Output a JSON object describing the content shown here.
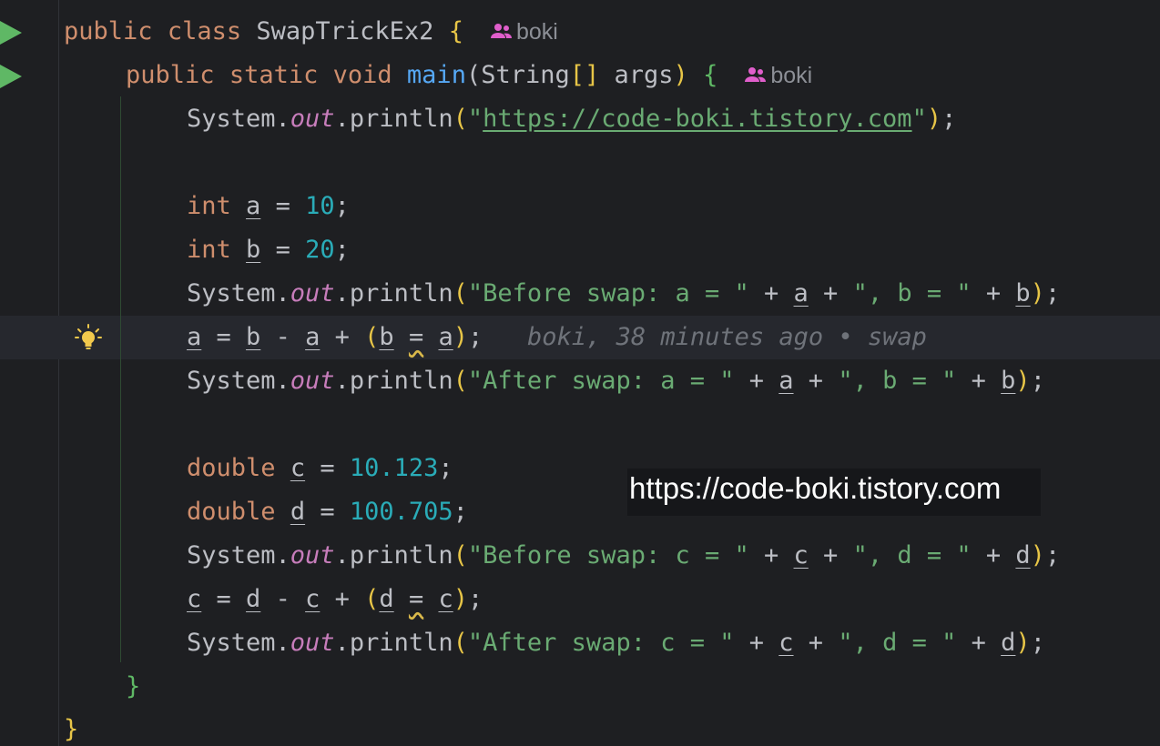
{
  "editor": {
    "lines": [
      {
        "kw1": "public",
        "kw2": "class",
        "name": "SwapTrickEx2",
        "brace": "{",
        "author": "boki"
      },
      {
        "kw1": "public",
        "kw2": "static",
        "kw3": "void",
        "fn": "main",
        "params_open": "(String",
        "brackets": "[]",
        "arg": " args",
        "paren_close": ")",
        "brace": "{",
        "author": "boki"
      },
      {
        "obj": "System.",
        "field": "out",
        "call": ".println",
        "paren_open": "(",
        "quote_open": "\"",
        "url": "https://code-boki.tistory.com",
        "quote_close": "\"",
        "paren_close": ")",
        "end": ";"
      },
      {
        "type": "int",
        "var": "a",
        "op": " = ",
        "value": "10",
        "end": ";"
      },
      {
        "type": "int",
        "var": "b",
        "op": " = ",
        "value": "20",
        "end": ";"
      },
      {
        "obj": "System.",
        "field": "out",
        "call": ".println",
        "str1": "\"Before swap: a = \"",
        "str2": "\", b = \"",
        "v1": "a",
        "v2": "b"
      },
      {
        "v1": "a",
        "v2": "b",
        "v3": "a",
        "v4": "b",
        "v5": "a",
        "blame": "boki, 38 minutes ago • swap"
      },
      {
        "obj": "System.",
        "field": "out",
        "call": ".println",
        "str1": "\"After swap: a = \"",
        "str2": "\", b = \"",
        "v1": "a",
        "v2": "b"
      },
      {
        "type": "double",
        "var": "c",
        "op": " = ",
        "value": "10.123",
        "end": ";"
      },
      {
        "type": "double",
        "var": "d",
        "op": " = ",
        "value": "100.705",
        "end": ";"
      },
      {
        "obj": "System.",
        "field": "out",
        "call": ".println",
        "str1": "\"Before swap: c = \"",
        "str2": "\", d = \"",
        "v1": "c",
        "v2": "d"
      },
      {
        "v1": "c",
        "v2": "d",
        "v3": "c",
        "v4": "d",
        "v5": "c"
      },
      {
        "obj": "System.",
        "field": "out",
        "call": ".println",
        "str1": "\"After swap: c = \"",
        "str2": "\", d = \"",
        "v1": "c",
        "v2": "d"
      },
      {
        "brace": "}"
      },
      {
        "brace": "}"
      }
    ]
  },
  "watermark": {
    "text": "https://code-boki.tistory.com"
  },
  "colors": {
    "background": "#1e1f22",
    "keyword": "#cf8e6d",
    "function": "#56a8f5",
    "number": "#2aacb8",
    "string": "#6aab73",
    "field": "#c77dbb",
    "run_icon": "#5fb865"
  },
  "icons": {
    "run": "run-gutter-icon",
    "intention": "lightbulb-icon",
    "authors": "users-icon"
  }
}
